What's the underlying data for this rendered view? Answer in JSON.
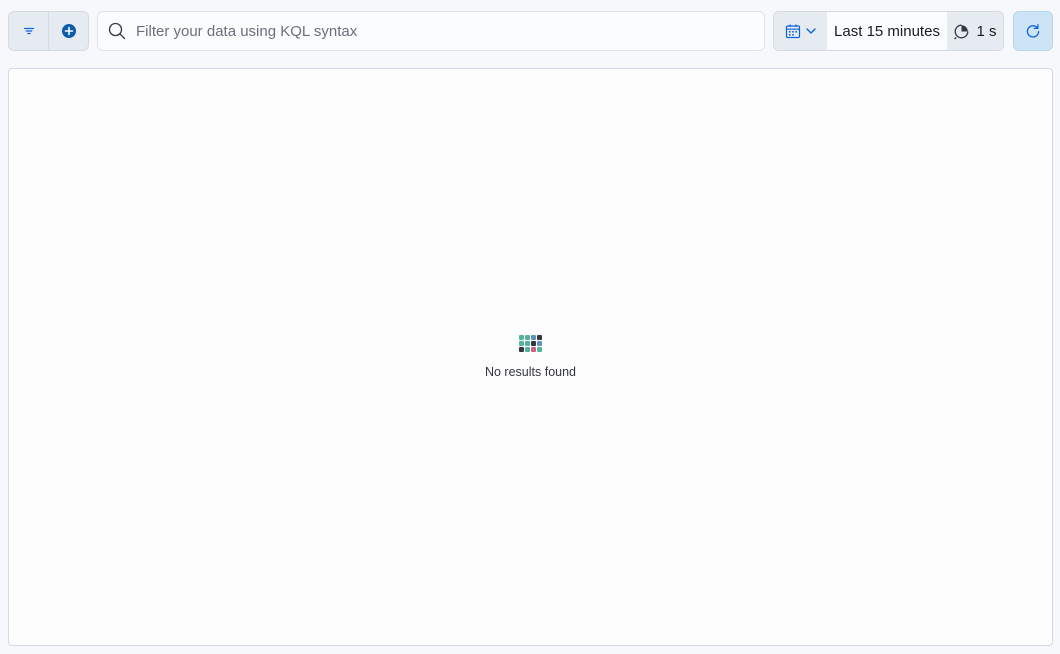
{
  "query_bar": {
    "search": {
      "placeholder": "Filter your data using KQL syntax",
      "value": ""
    },
    "filter_menu_icon": "filter-menu-icon",
    "add_filter_icon": "add-filter-icon"
  },
  "date_picker": {
    "quick_menu_icon": "calendar-icon",
    "range_label": "Last 15 minutes",
    "refresh_interval_label": "1 s"
  },
  "refresh": {
    "icon": "refresh-icon"
  },
  "results": {
    "empty_message": "No results found"
  },
  "colors": {
    "accent": "#07c",
    "primary_button_bg": "#cce4f5",
    "empty_grid": [
      "#54b399",
      "#54b399",
      "#6092c0",
      "#343741",
      "#54b399",
      "#54b399",
      "#343741",
      "#6092c0",
      "#343741",
      "#54b399",
      "#d36086",
      "#54b399"
    ]
  }
}
